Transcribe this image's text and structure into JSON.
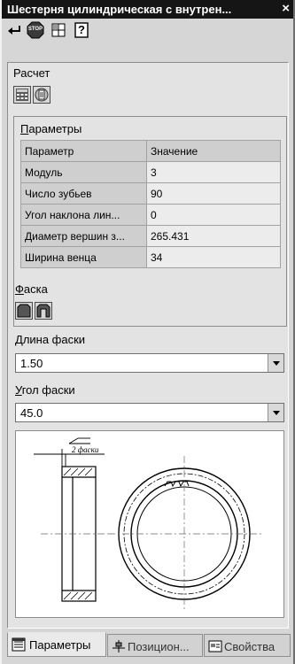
{
  "window": {
    "title": "Шестерня цилиндрическая с внутрен...",
    "close_glyph": "×"
  },
  "toolbar": {
    "icons": [
      "enter-icon",
      "stop-icon",
      "grid-icon",
      "help-icon"
    ],
    "stop_text": "STOP",
    "help_text": "?"
  },
  "calc": {
    "label": "Расчет",
    "icons": [
      "calculator-icon",
      "document-icon"
    ]
  },
  "params": {
    "title_first": "П",
    "title_rest": "араметры",
    "headers": [
      "Параметр",
      "Значение"
    ],
    "rows": [
      {
        "name": "Модуль",
        "value": "3"
      },
      {
        "name": "Число зубьев",
        "value": "90"
      },
      {
        "name": "Угол наклона лин...",
        "value": "0"
      },
      {
        "name": "Диаметр вершин з...",
        "value": "265.431"
      },
      {
        "name": "Ширина венца",
        "value": "34"
      }
    ]
  },
  "chamfer": {
    "label_first": "Ф",
    "label_rest": "аска",
    "icons": [
      "chamfer-outer-icon",
      "chamfer-inner-icon"
    ],
    "length_label_first": "Д",
    "length_label_rest": "лина фаски",
    "length_value": "1.50",
    "angle_label_first": "У",
    "angle_label_rest": "гол фаски",
    "angle_value": "45.0"
  },
  "preview": {
    "callout_text": "2 фаски"
  },
  "tabs": [
    {
      "label": "Параметры",
      "icon": "list-icon",
      "active": true
    },
    {
      "label": "Позицион...",
      "icon": "position-icon",
      "active": false
    },
    {
      "label": "Свойства",
      "icon": "properties-icon",
      "active": false
    }
  ]
}
